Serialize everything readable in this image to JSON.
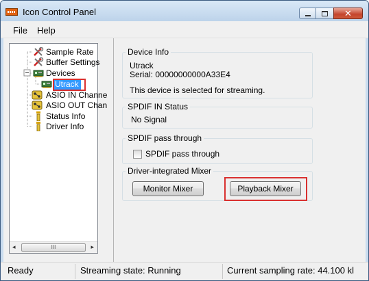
{
  "window": {
    "title": "Icon Control Panel"
  },
  "menu": {
    "file": "File",
    "help": "Help"
  },
  "tree": {
    "items": [
      {
        "label": "Sample Rate",
        "icon": "tools-icon"
      },
      {
        "label": "Buffer Settings",
        "icon": "tools-icon"
      },
      {
        "label": "Devices",
        "icon": "device-card-icon"
      },
      {
        "label": "Utrack",
        "icon": "device-card-icon",
        "selected": true
      },
      {
        "label": "ASIO IN Channe",
        "icon": "channel-icon"
      },
      {
        "label": "ASIO OUT Chan",
        "icon": "channel-icon"
      },
      {
        "label": "Status Info",
        "icon": "info-icon"
      },
      {
        "label": "Driver Info",
        "icon": "info-icon"
      }
    ],
    "scroll_left": "◂",
    "scroll_right": "▸",
    "scroll_thumb": "III"
  },
  "device_info": {
    "title": "Device Info",
    "name": "Utrack",
    "serial": "Serial: 00000000000A33E4",
    "note": "This device is selected for streaming."
  },
  "spdif_status": {
    "title": "SPDIF IN Status",
    "value": "No Signal"
  },
  "spdif_pass": {
    "title": "SPDIF pass through",
    "checkbox_label": "SPDIF pass through",
    "checked": false
  },
  "mixer": {
    "title": "Driver-integrated Mixer",
    "monitor_label": "Monitor Mixer",
    "playback_label": "Playback Mixer"
  },
  "status": {
    "ready": "Ready",
    "streaming": "Streaming state: Running",
    "rate": "Current sampling rate: 44.100 kl"
  },
  "colors": {
    "highlight": "#d9302f",
    "selection": "#3399ff",
    "titlebar": "#c9dcef"
  }
}
